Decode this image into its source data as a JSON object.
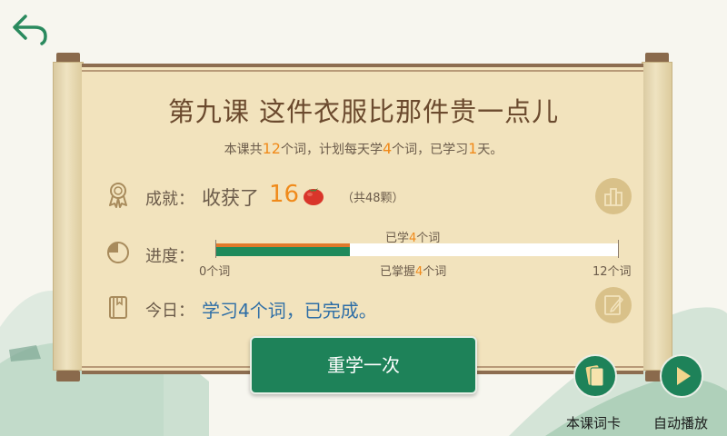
{
  "lesson": {
    "title": "第九课  这件衣服比那件贵一点儿",
    "summary": {
      "p1": "本课共",
      "total_words": "12",
      "p2": "个词，计划每天学",
      "daily_words": "4",
      "p3": "个词，已学习",
      "days_studied": "1",
      "p4": "天。"
    }
  },
  "achievement": {
    "label": "成就：",
    "text": "收获了",
    "count": "16",
    "total": "（共48颗）"
  },
  "progress": {
    "label": "进度：",
    "learned_prefix": "已学",
    "learned_count": "4",
    "learned_suffix": "个词",
    "min_label": "0个词",
    "mastered_prefix": "已掌握",
    "mastered_count": "4",
    "mastered_suffix": "个词",
    "max_label": "12个词",
    "learned_fraction": 0.333,
    "mastered_fraction": 0.333
  },
  "today": {
    "label": "今日：",
    "status": "学习4个词，已完成。"
  },
  "buttons": {
    "relearn": "重学一次",
    "word_cards": "本课词卡",
    "autoplay": "自动播放"
  },
  "colors": {
    "accent_green": "#1e8259",
    "highlight_orange": "#f08a1a",
    "paper": "#f2e3bd",
    "link_blue": "#2e6ea6"
  }
}
